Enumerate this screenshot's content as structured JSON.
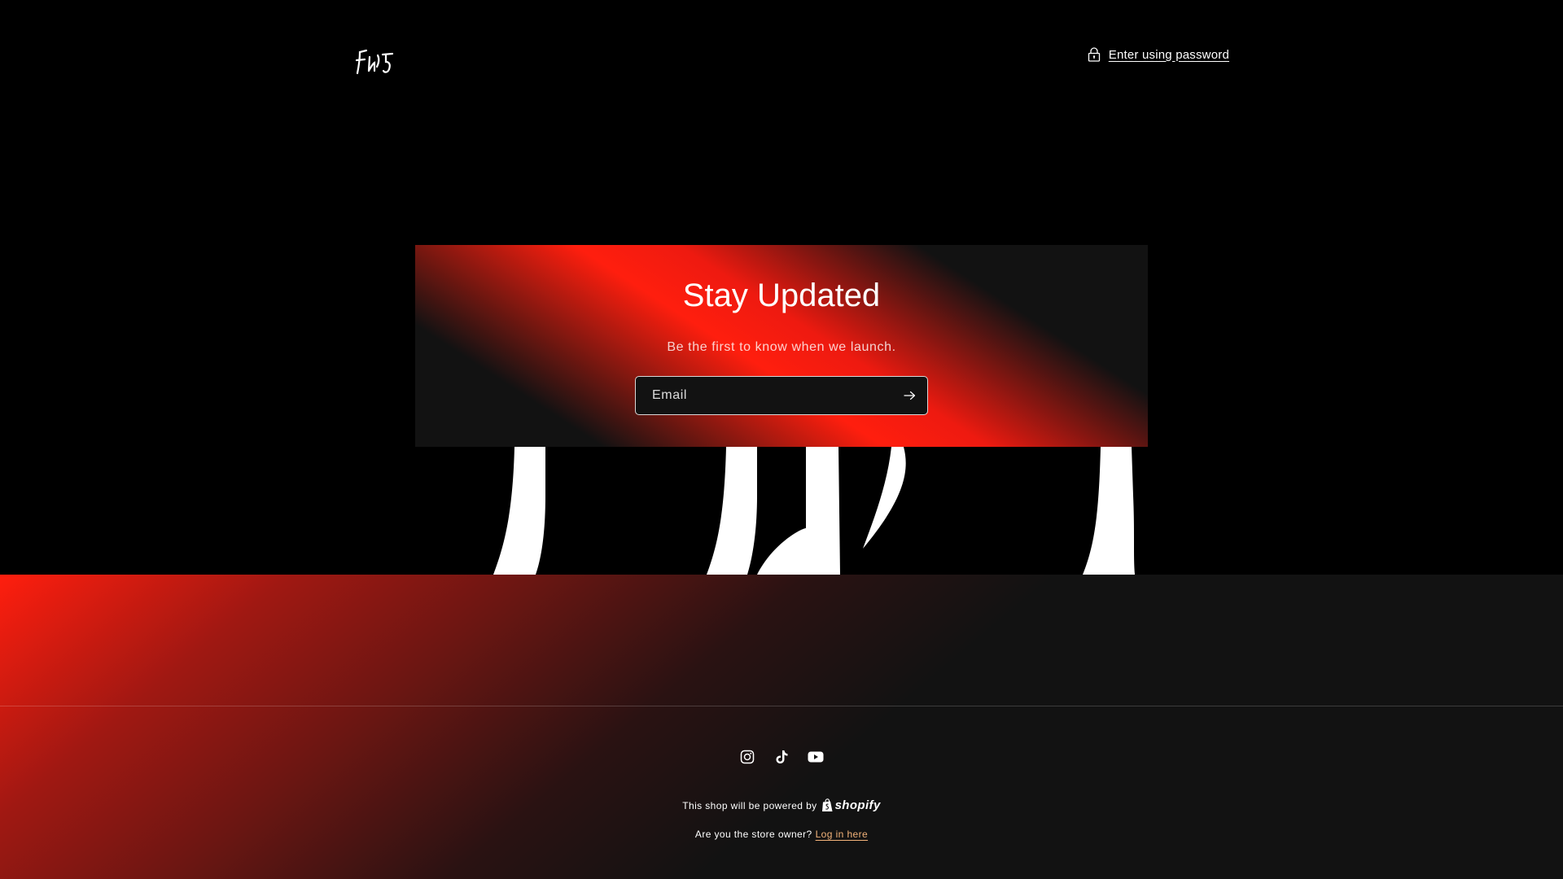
{
  "header": {
    "logo_alt": "Fuji logo",
    "password_link_label": "Enter using password"
  },
  "newsletter": {
    "title": "Stay Updated",
    "subtitle": "Be the first to know when we launch.",
    "email_placeholder": "Email",
    "submit_icon": "arrow-right-icon"
  },
  "footer": {
    "social": [
      {
        "name": "Instagram",
        "icon": "instagram-icon"
      },
      {
        "name": "TikTok",
        "icon": "tiktok-icon"
      },
      {
        "name": "YouTube",
        "icon": "youtube-icon"
      }
    ],
    "powered_text": "This shop will be powered by",
    "shopify_label": "shopify",
    "owner_text": "Are you the store owner?",
    "login_label": "Log in here"
  },
  "colors": {
    "accent_red": "#ff1e0e",
    "background": "#000000",
    "panel": "#121212",
    "link_orange": "#f3b37a"
  }
}
